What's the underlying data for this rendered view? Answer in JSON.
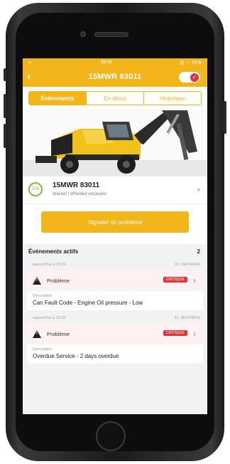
{
  "status_bar": {
    "time": "16:14",
    "battery": "@ ⚡ 73 %"
  },
  "nav": {
    "title": "15MWR 83011",
    "back_icon": "chevron-left-icon",
    "toggle_icon": "check-icon"
  },
  "tabs": [
    {
      "label": "Événements",
      "active": true
    },
    {
      "label": "En direct",
      "active": false
    },
    {
      "label": "Historique",
      "active": false
    }
  ],
  "machine": {
    "badge": "100",
    "name": "15MWR 83011",
    "subtitle": "Wacker | Wheeled excavator"
  },
  "cta": {
    "label": "Signaler un problème"
  },
  "events": {
    "title": "Événements actifs",
    "count": "2",
    "items": [
      {
        "date": "aujourd'hui à 15:51",
        "id": "ID: 3EFFA9A4",
        "type": "Problème",
        "severity": "CRITIQUE",
        "desc_label": "Description",
        "desc": "Can Fault Code - Engine Oil pressure - Low"
      },
      {
        "date": "aujourd'hui à 15:51",
        "id": "ID: 3EDF4EFE",
        "type": "Problème",
        "severity": "CRITIQUE",
        "desc_label": "Description",
        "desc": "Overdue Service - 2 days overdue"
      }
    ]
  },
  "colors": {
    "accent": "#f2b51a",
    "critical": "#e0353a",
    "ok": "#7bc043"
  }
}
